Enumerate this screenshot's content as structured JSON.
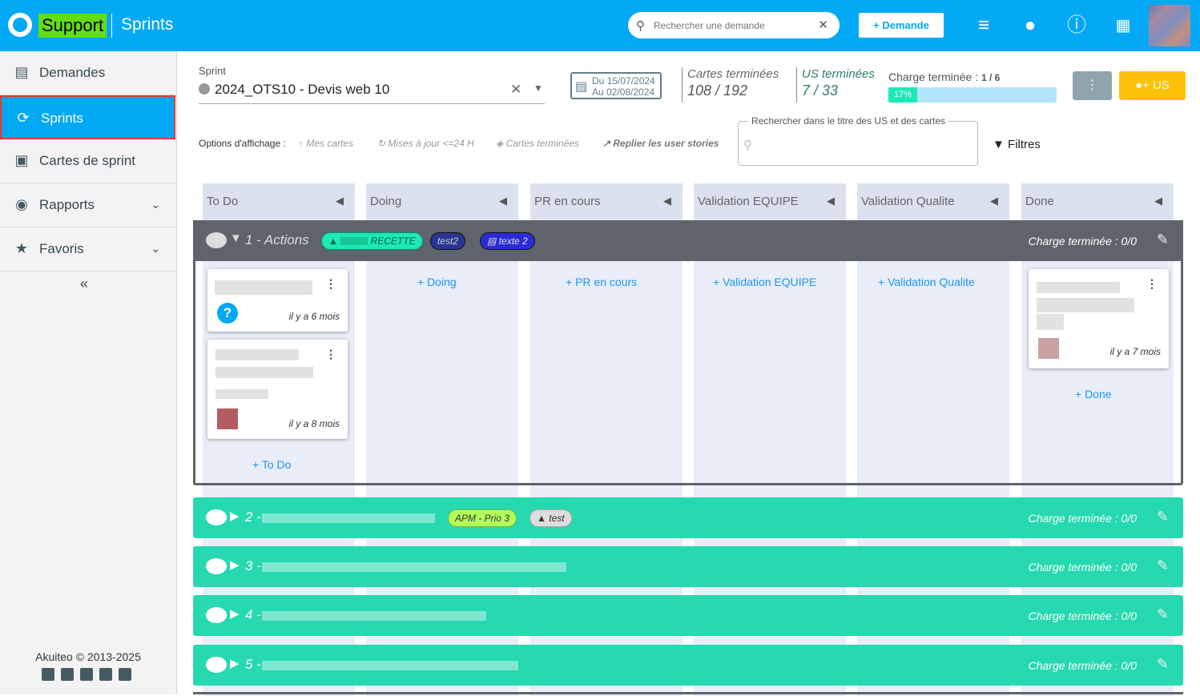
{
  "header": {
    "brand": "Support",
    "page_name": "Sprints",
    "search_placeholder": "Rechercher une demande",
    "new_button": "+ Demande"
  },
  "sidebar": {
    "items": [
      {
        "label": "Demandes"
      },
      {
        "label": "Sprints"
      },
      {
        "label": "Cartes de sprint"
      },
      {
        "label": "Rapports"
      },
      {
        "label": "Favoris"
      }
    ],
    "copyright": "Akuiteo © 2013-2025"
  },
  "sprint": {
    "label": "Sprint",
    "value": "2024_OTS10 - Devis web 10",
    "date_from": "Du 15/07/2024",
    "date_to": "Au 02/08/2024"
  },
  "stats": {
    "cards_label": "Cartes terminées",
    "cards_value": "108 / 192",
    "us_label": "US terminées",
    "us_value": "7 / 33",
    "charge_label": "Charge terminée :",
    "charge_value": "1 / 6",
    "progress_text": "17%",
    "progress_pct": 17
  },
  "actions": {
    "add_us": "+ US"
  },
  "options": {
    "label": "Options d'affichage :",
    "mes_cartes": "Mes cartes",
    "mises_a_jour": "Mises à jour <=24 H",
    "cartes_terminees": "Cartes terminées",
    "replier": "Replier les user stories",
    "search_label": "Rechercher dans le titre des US et des cartes",
    "filters": "Filtres"
  },
  "columns": [
    "To Do",
    "Doing",
    "PR en cours",
    "Validation EQUIPE",
    "Validation Qualite",
    "Done"
  ],
  "groups": [
    {
      "title": "1 - Actions",
      "charge": "Charge terminée : 0/0",
      "tags": [
        "RECETTE",
        "test2",
        "texte 2"
      ]
    },
    {
      "title": "2 -",
      "charge": "Charge terminée : 0/0",
      "tags": [
        "APM - Prio 3",
        "test"
      ]
    },
    {
      "title": "3 -",
      "charge": "Charge terminée : 0/0"
    },
    {
      "title": "4 -",
      "charge": "Charge terminée : 0/0"
    },
    {
      "title": "5 -",
      "charge": "Charge terminée : 0/0"
    }
  ],
  "cards": [
    {
      "age": "il y a 6 mois"
    },
    {
      "age": "il y a 8 mois"
    },
    {
      "age": "il y a 7 mois"
    }
  ],
  "add_labels": [
    "+ To Do",
    "+ Doing",
    "+ PR en cours",
    "+ Validation EQUIPE",
    "+ Validation Qualite",
    "+ Done"
  ],
  "colors": {
    "accent": "#03a9f4",
    "brand_bg": "#64dd17",
    "group_green": "#26d9b0",
    "group_dark": "#5f636b",
    "cta": "#ffc107"
  }
}
